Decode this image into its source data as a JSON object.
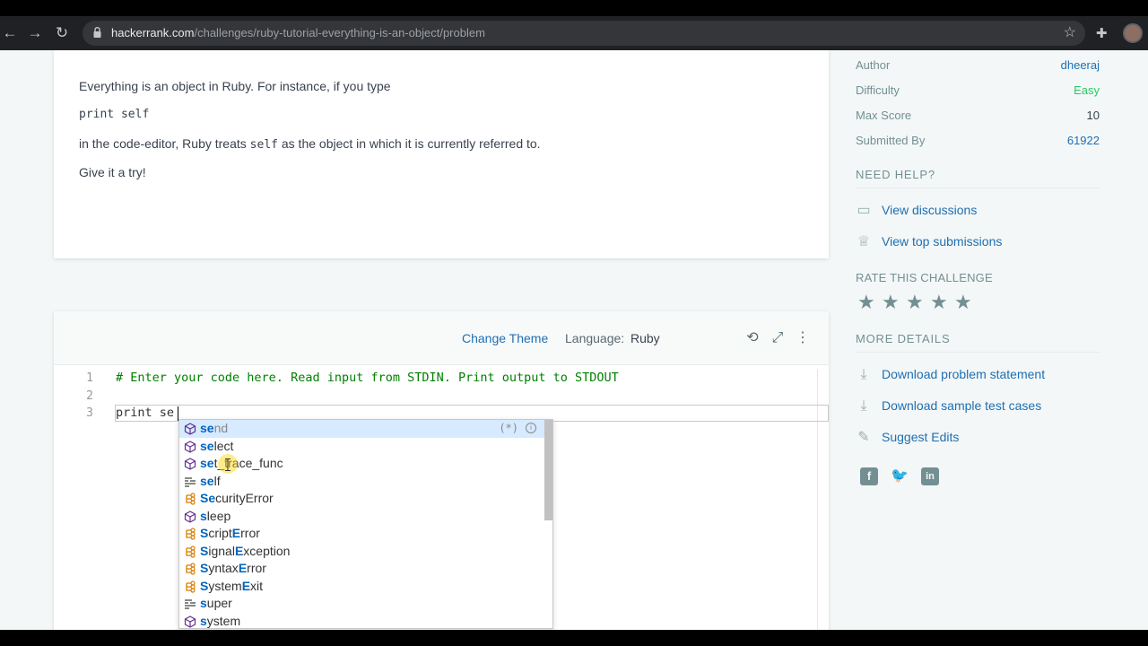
{
  "browser": {
    "url_host": "hackerrank.com",
    "url_path": "/challenges/ruby-tutorial-everything-is-an-object/problem"
  },
  "problem": {
    "line1": "Everything is an object in Ruby. For instance, if you type",
    "line2_code": "print self",
    "line3_pre": "in the code-editor, Ruby treats ",
    "line3_code": "self",
    "line3_post": " as the object in which it is currently referred to.",
    "line4": "Give it a try!"
  },
  "editor": {
    "change_theme": "Change Theme",
    "language_label": "Language:",
    "language_value": "Ruby",
    "lines": [
      {
        "num": "1",
        "text": "# Enter your code here. Read input from STDIN. Print output to STDOUT"
      },
      {
        "num": "2",
        "text": ""
      },
      {
        "num": "3",
        "text": "print se"
      }
    ],
    "suggestions": [
      {
        "match": "se",
        "rest": "nd",
        "kind": "method",
        "detail": "(*)"
      },
      {
        "match": "se",
        "rest": "lect",
        "kind": "method"
      },
      {
        "match": "se",
        "rest": "t_trace_func",
        "kind": "method"
      },
      {
        "match": "se",
        "rest": "lf",
        "kind": "keyword"
      },
      {
        "match": "Se",
        "rest": "curityError",
        "kind": "class"
      },
      {
        "match": "s",
        "rest": "leep",
        "kind": "method"
      },
      {
        "match": "S",
        "rest": "criptError",
        "kind": "class"
      },
      {
        "match": "S",
        "rest": "ignalException",
        "kind": "class"
      },
      {
        "match": "S",
        "rest": "yntaxError",
        "kind": "class"
      },
      {
        "match": "S",
        "rest": "ystemExit",
        "kind": "class"
      },
      {
        "match": "s",
        "rest": "uper",
        "kind": "keyword"
      },
      {
        "match": "s",
        "rest": "ystem",
        "kind": "method"
      }
    ]
  },
  "sidebar": {
    "details": [
      {
        "key": "Author",
        "value": "dheeraj",
        "style": "link"
      },
      {
        "key": "Difficulty",
        "value": "Easy",
        "style": "easy"
      },
      {
        "key": "Max Score",
        "value": "10",
        "style": "plain"
      },
      {
        "key": "Submitted By",
        "value": "61922",
        "style": "link"
      }
    ],
    "need_help_title": "NEED HELP?",
    "help_links": [
      "View discussions",
      "View top submissions"
    ],
    "rate_title": "RATE THIS CHALLENGE",
    "rating_stars": 5,
    "more_title": "MORE DETAILS",
    "more_links": [
      "Download problem statement",
      "Download sample test cases",
      "Suggest Edits"
    ]
  },
  "colors": {
    "link": "#1f6fb2",
    "easy": "#2ec866",
    "comment": "#008000",
    "suggest_match": "#0066bf"
  }
}
